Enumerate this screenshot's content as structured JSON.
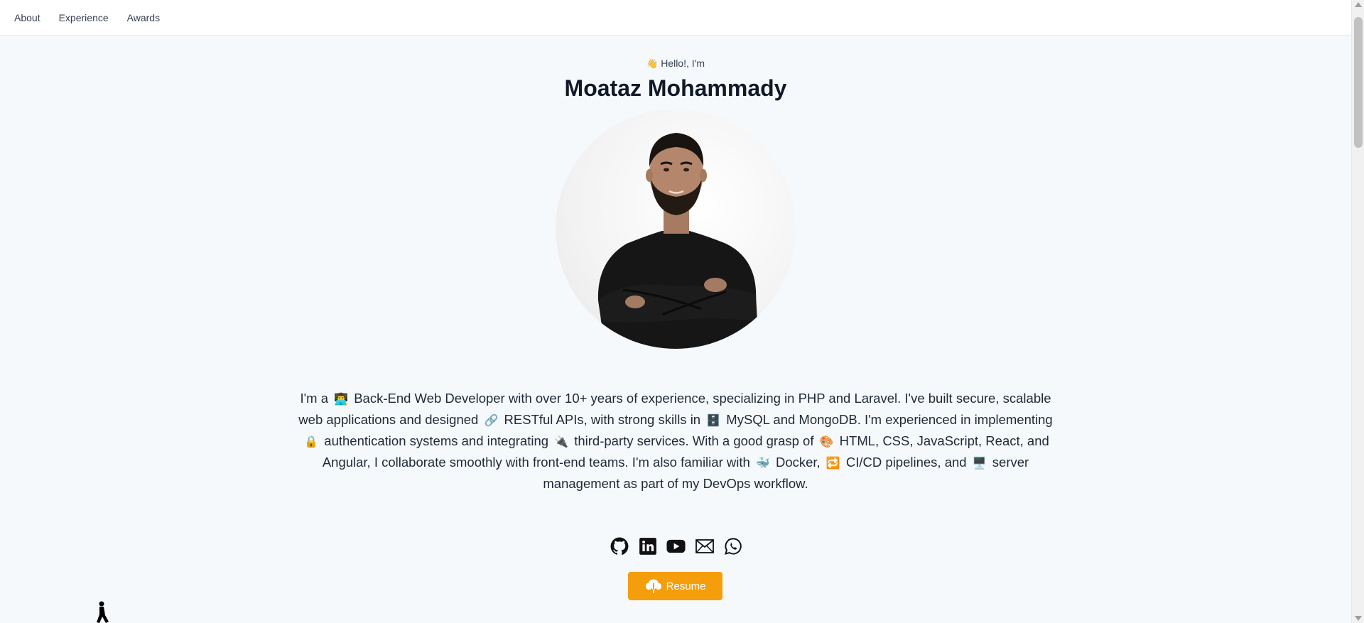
{
  "nav": {
    "items": [
      {
        "label": "About"
      },
      {
        "label": "Experience"
      },
      {
        "label": "Awards"
      }
    ]
  },
  "hero": {
    "greeting": "Hello!, I'm",
    "name": "Moataz Mohammady",
    "bio": {
      "part1": "I'm a",
      "part2": "Back-End Web Developer with over 10+ years of experience, specializing in PHP and Laravel. I've built secure, scalable web applications and designed",
      "part3": "RESTful APIs, with strong skills in",
      "part4": "MySQL and MongoDB. I'm experienced in implementing",
      "part5": "authentication systems and integrating",
      "part6": "third-party services. With a good grasp of",
      "part7": "HTML, CSS, JavaScript, React, and Angular, I collaborate smoothly with front-end teams. I'm also familiar with",
      "part8": "Docker,",
      "part9": "CI/CD pipelines, and",
      "part10": "server management as part of my DevOps workflow."
    }
  },
  "socials": {
    "icons": [
      "github-icon",
      "linkedin-icon",
      "youtube-icon",
      "email-icon",
      "whatsapp-icon"
    ]
  },
  "resume": {
    "label": "Resume"
  },
  "colors": {
    "accent": "#f59e0b",
    "background": "#f6f9fc",
    "text": "#1f2937"
  }
}
